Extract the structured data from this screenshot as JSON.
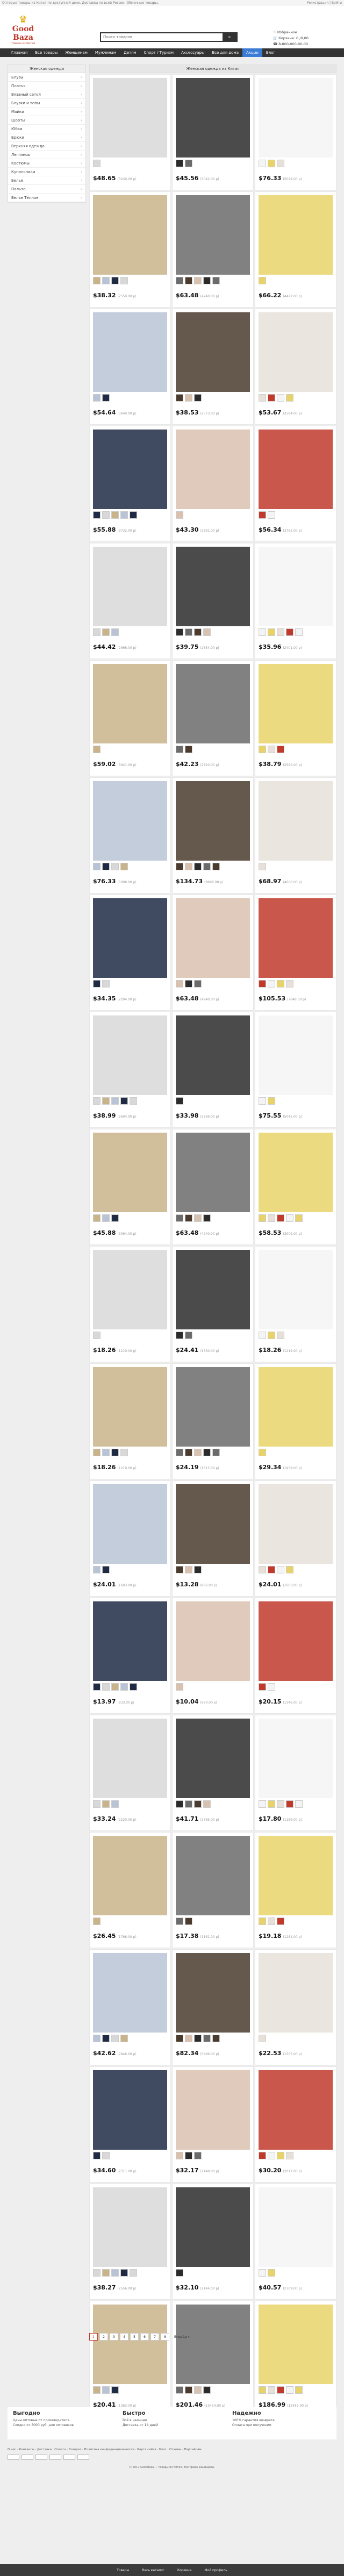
{
  "topbar": {
    "left": "Оптовые товары из Китая по доступной цене. Доставка по всей России. Обменные товары.",
    "right": "Регистрация | Войти"
  },
  "logo": {
    "crown": "♛",
    "name": "Good Baza",
    "sub": "товары из Китая"
  },
  "search": {
    "placeholder": "Поиск товаров",
    "button_icon": "search-icon"
  },
  "header_right": {
    "favorites": "♡ Избранное",
    "cart": "🛒 Корзина: 0 /0,00",
    "phone": "☎ 8-800-000-00-00"
  },
  "nav": [
    "Главная",
    "Все товары",
    "Женщинам",
    "Мужчинам",
    "Детям",
    "Спорт / Туризм",
    "Аксессуары",
    "Все для дома",
    "Акции",
    "Блог"
  ],
  "side": {
    "title": "Женская одежда",
    "items": [
      "Блузы",
      "Платья",
      "Вязаный сетой",
      "Блузки и топы",
      "Майки",
      "Шорты",
      "Юбки",
      "Брюки",
      "Верхняя одежда",
      "Леггинсы",
      "Костюмы",
      "Купальники",
      "Белье",
      "Пальто",
      "Белье Тёплое"
    ]
  },
  "main_title": "Женская одежда из Китая",
  "products": [
    {
      "price": "$48.65",
      "old": "(3249.00 р)"
    },
    {
      "price": "$45.56",
      "old": "(3042.00 р)"
    },
    {
      "price": "$76.33",
      "old": "(5098.00 р)"
    },
    {
      "price": "$38.32",
      "old": "(2559.00 р)"
    },
    {
      "price": "$63.48",
      "old": "(4240.00 р)"
    },
    {
      "price": "$66.22",
      "old": "(4422.00 р)"
    },
    {
      "price": "$54.64",
      "old": "(3649.00 р)"
    },
    {
      "price": "$38.53",
      "old": "(2573.00 р)"
    },
    {
      "price": "$53.67",
      "old": "(3584.00 р)"
    },
    {
      "price": "$55.88",
      "old": "(3732.00 р)"
    },
    {
      "price": "$43.30",
      "old": "(2891.00 р)"
    },
    {
      "price": "$56.34",
      "old": "(3762.00 р)"
    },
    {
      "price": "$44.42",
      "old": "(2966.00 р)"
    },
    {
      "price": "$39.75",
      "old": "(2654.00 р)"
    },
    {
      "price": "$35.96",
      "old": "(2401.00 р)"
    },
    {
      "price": "$59.02",
      "old": "(3941.00 р)"
    },
    {
      "price": "$42.23",
      "old": "(2820.00 р)"
    },
    {
      "price": "$38.79",
      "old": "(2590.00 р)"
    },
    {
      "price": "$76.33",
      "old": "(5098.00 р)"
    },
    {
      "price": "$134.73",
      "old": "(8998.00 р)"
    },
    {
      "price": "$68.97",
      "old": "(4606.00 р)"
    },
    {
      "price": "$34.35",
      "old": "(2294.00 р)"
    },
    {
      "price": "$63.48",
      "old": "(4240.00 р)"
    },
    {
      "price": "$105.53",
      "old": "(7048.00 р)"
    },
    {
      "price": "$38.99",
      "old": "(2604.00 р)"
    },
    {
      "price": "$33.98",
      "old": "(2269.00 р)"
    },
    {
      "price": "$75.55",
      "old": "(5045.00 р)"
    },
    {
      "price": "$45.88",
      "old": "(3064.00 р)"
    },
    {
      "price": "$63.48",
      "old": "(4240.00 р)"
    },
    {
      "price": "$58.53",
      "old": "(3909.00 р)"
    }
  ],
  "small_products": [
    {
      "price": "$18.26",
      "old": "(1219.00 р)"
    },
    {
      "price": "$24.41",
      "old": "(1630.00 р)"
    },
    {
      "price": "$18.26",
      "old": "(1219.00 р)"
    },
    {
      "price": "$18.26",
      "old": "(1219.00 р)"
    },
    {
      "price": "$24.19",
      "old": "(1615.00 р)"
    },
    {
      "price": "$29.34",
      "old": "(1959.00 р)"
    },
    {
      "price": "$24.01",
      "old": "(1603.00 р)"
    },
    {
      "price": "$13.28",
      "old": "(886.00 р)"
    },
    {
      "price": "$24.01",
      "old": "(1603.00 р)"
    },
    {
      "price": "$13.97",
      "old": "(933.00 р)"
    },
    {
      "price": "$10.04",
      "old": "(670.00 р)"
    },
    {
      "price": "$20.15",
      "old": "(1346.00 р)"
    },
    {
      "price": "$33.24",
      "old": "(2220.00 р)"
    },
    {
      "price": "$41.71",
      "old": "(2785.00 р)"
    },
    {
      "price": "$17.80",
      "old": "(1189.00 р)"
    },
    {
      "price": "$26.45",
      "old": "(1766.00 р)"
    },
    {
      "price": "$17.38",
      "old": "(1161.00 р)"
    },
    {
      "price": "$19.18",
      "old": "(1281.00 р)"
    },
    {
      "price": "$42.62",
      "old": "(2846.00 р)"
    },
    {
      "price": "$82.34",
      "old": "(5499.00 р)"
    },
    {
      "price": "$22.53",
      "old": "(1505.00 р)"
    },
    {
      "price": "$34.60",
      "old": "(2311.00 р)"
    },
    {
      "price": "$32.17",
      "old": "(2148.00 р)"
    },
    {
      "price": "$30.20",
      "old": "(2017.00 р)"
    },
    {
      "price": "$38.27",
      "old": "(2556.00 р)"
    },
    {
      "price": "$32.10",
      "old": "(2144.00 р)"
    },
    {
      "price": "$40.57",
      "old": "(2709.00 р)"
    },
    {
      "price": "$20.41",
      "old": "(1363.00 р)"
    },
    {
      "price": "$201.46",
      "old": "(13454.00 р)"
    },
    {
      "price": "$186.99",
      "old": "(12487.00 р)"
    }
  ],
  "pager": [
    "1",
    "2",
    "3",
    "4",
    "5",
    "6",
    "7",
    "8"
  ],
  "pager_next": "Вперёд »",
  "features": [
    {
      "title": "Выгодно",
      "lines": [
        "Цены оптовые от производителя",
        "Скидки от 5000 руб. для оптовиков"
      ]
    },
    {
      "title": "Быстро",
      "lines": [
        "Всё в наличии",
        "Доставка от 14 дней"
      ]
    },
    {
      "title": "Надежно",
      "lines": [
        "100% гарантия возврата",
        "Оплата при получении"
      ]
    }
  ],
  "footer_links": "О нас · Контакты · Доставка · Оплата · Возврат · Политика конфиденциальности · Карта сайта · Блог · Отзывы · Партнёрам",
  "copyright": "© 2017 GoodBaza — товары из Китая. Все права защищены.",
  "bottom_bar": [
    "Товары",
    "Весь каталог",
    "Корзина",
    "Мой профиль"
  ],
  "colors": {
    "nav_bg": "#333333",
    "accent": "#3a7bd5",
    "logo": "#c0392b"
  }
}
